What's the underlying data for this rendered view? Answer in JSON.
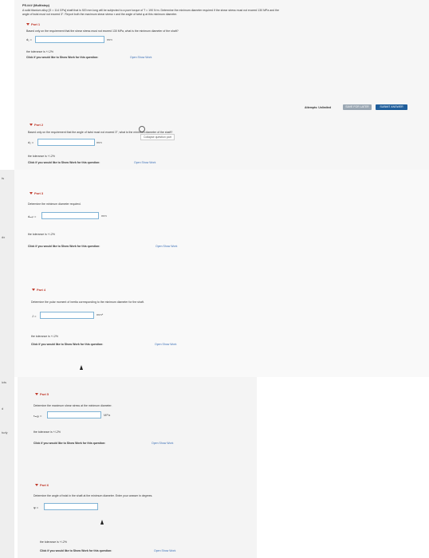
{
  "problem": {
    "title": "P5.### (Multistep)",
    "line1": "A solid titanium alloy [G = 114 GPa] shaft that is 920 mm long will be subjected to a pure torque of T = 190 N·m. Determine the minimum diameter required if the shear stress must not exceed 130 MPa and the",
    "line2": "angle of twist must not exceed 3°. Report both the maximum shear stress τ and the angle of twist φ at this minimum diameter."
  },
  "parts": [
    {
      "label": "Part 1",
      "question": "Based only on the requirement that the shear stress must not exceed 130 MPa, what is the minimum diameter of the shaft?",
      "symbol": "d₁ =",
      "unit": "mm",
      "tolerance": "the tolerance is +/-2%",
      "work_prompt": "Click if you would like to Show Work for this question:",
      "work_link": "Open Show Work"
    },
    {
      "label": "Part 2",
      "question": "Based only on the requirement that the angle of twist must not exceed 3°, what is the minimum diameter of the shaft?",
      "symbol": "d₂ =",
      "unit": "mm",
      "tolerance": "the tolerance is +/-2%",
      "work_prompt": "Click if you would like to Show Work for this question:",
      "work_link": "Open Show Work",
      "tooltip": "Collapse question part"
    },
    {
      "label": "Part 3",
      "question": "Determine the minimum diameter required.",
      "symbol": "dₘᵢₙ =",
      "unit": "mm",
      "tolerance": "the tolerance is +/-2%",
      "work_prompt": "Click if you would like to Show Work for this question:",
      "work_link": "Open Show Work"
    },
    {
      "label": "Part 4",
      "question": "Determine the polar moment of inertia corresponding to the minimum diameter for the shaft.",
      "symbol": "J =",
      "unit": "mm⁴",
      "tolerance": "the tolerance is +/-2%",
      "work_prompt": "Click if you would like to Show Work for this question:",
      "work_link": "Open Show Work"
    },
    {
      "label": "Part 5",
      "question": "Determine the maximum shear stress at the minimum diameter.",
      "symbol": "τₘₐₓ =",
      "unit": "MPa",
      "tolerance": "the tolerance is +/-2%",
      "work_prompt": "Click if you would like to Show Work for this question:",
      "work_link": "Open Show Work"
    },
    {
      "label": "Part 6",
      "question": "Determine the angle of twist in the shaft at the minimum diameter.  Enter your answer in degrees.",
      "symbol": "φ =",
      "unit": "",
      "tolerance": "the tolerance is +/-2%",
      "work_prompt": "Click if you would like to Show Work for this question:",
      "work_link": "Open Show Work"
    }
  ],
  "attempts": {
    "label": "Attempts: Unlimited",
    "save_button": "SAVE FOR LATER",
    "submit_button": "SUBMIT ANSWER"
  },
  "left_strip": [
    "ts",
    "dx",
    "icts",
    "d",
    "tudy"
  ]
}
